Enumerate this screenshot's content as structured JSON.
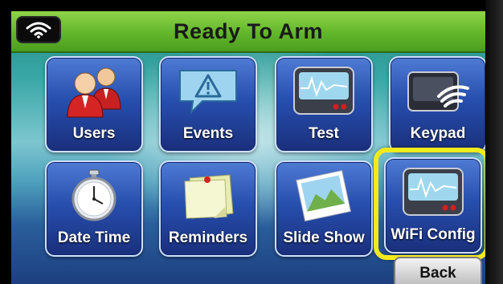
{
  "header": {
    "title": "Ready To Arm",
    "status_icon": "wifi-icon",
    "accent_color": "#62b62a"
  },
  "tiles": [
    {
      "label": "Users",
      "icon": "users-icon"
    },
    {
      "label": "Events",
      "icon": "events-warning-icon"
    },
    {
      "label": "Test",
      "icon": "test-monitor-icon"
    },
    {
      "label": "Keypad",
      "icon": "keypad-wifi-icon"
    },
    {
      "label": "Date Time",
      "icon": "stopwatch-icon"
    },
    {
      "label": "Reminders",
      "icon": "sticky-note-icon"
    },
    {
      "label": "Slide Show",
      "icon": "photo-icon"
    },
    {
      "label": "WiFi Config",
      "icon": "wifi-config-monitor-icon"
    }
  ],
  "highlight": {
    "target": "WiFi Config",
    "color": "#f2ea1b"
  },
  "footer": {
    "back_label": "Back"
  }
}
